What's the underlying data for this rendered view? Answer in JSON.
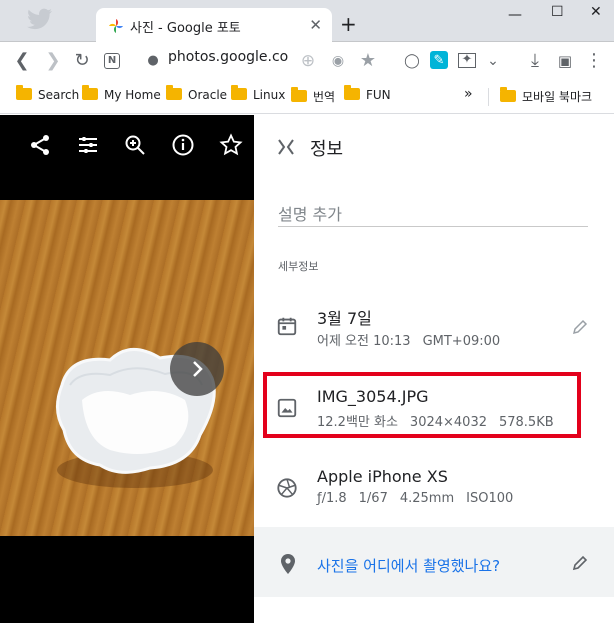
{
  "browser": {
    "tab_title": "사진 - Google 포토",
    "url": "photos.google.com",
    "bookmarks": [
      "Search",
      "My Home",
      "Oracle",
      "Linux",
      "번역",
      "FUN"
    ],
    "mobile_bookmarks": "모바일 북마크",
    "overflow": "»"
  },
  "info": {
    "title": "정보",
    "description_placeholder": "설명 추가",
    "section_label": "세부정보",
    "date": {
      "main": "3월 7일",
      "time": "어제 오전 10:13",
      "timezone": "GMT+09:00"
    },
    "file": {
      "name": "IMG_3054.JPG",
      "megapixels": "12.2백만 화소",
      "dimensions": "3024×4032",
      "size": "578.5KB"
    },
    "camera": {
      "model": "Apple iPhone XS",
      "aperture": "ƒ/1.8",
      "shutter": "1/67",
      "focal": "4.25mm",
      "iso": "ISO100"
    },
    "location_prompt": "사진을 어디에서 촬영했나요?"
  },
  "colors": {
    "accent": "#1a73e8",
    "highlight": "#e3001b",
    "folder": "#f5b400"
  }
}
